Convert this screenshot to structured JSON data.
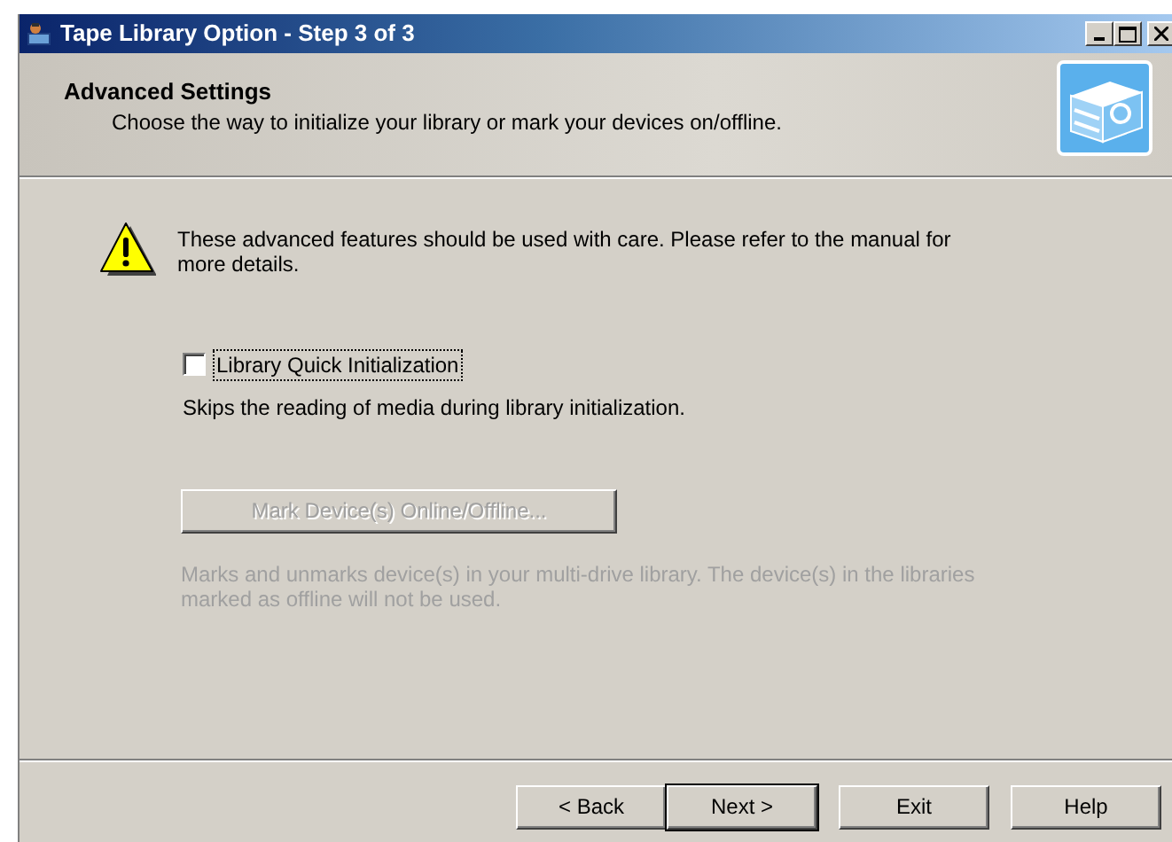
{
  "window": {
    "title": "Tape Library Option - Step 3 of 3"
  },
  "header": {
    "title": "Advanced Settings",
    "subtitle": "Choose the way to initialize your library or mark your devices on/offline."
  },
  "warning": {
    "text": "These advanced features should be used with care. Please refer to the manual for more details."
  },
  "options": [
    {
      "kind": "checkbox",
      "label": "Library Quick Initialization",
      "checked": false,
      "focused": true,
      "disabled": false,
      "description": "Skips the reading of media during library initialization."
    },
    {
      "kind": "button",
      "label": "Mark Device(s) Online/Offline...",
      "focused": false,
      "disabled": true,
      "description": "Marks and unmarks device(s) in your multi-drive library. The device(s) in the libraries marked as offline will not be used."
    }
  ],
  "buttons": [
    {
      "label": "< Back",
      "default": false
    },
    {
      "label": "Next >",
      "default": true
    },
    {
      "label": "Exit",
      "default": false
    },
    {
      "label": "Help",
      "default": false
    }
  ]
}
